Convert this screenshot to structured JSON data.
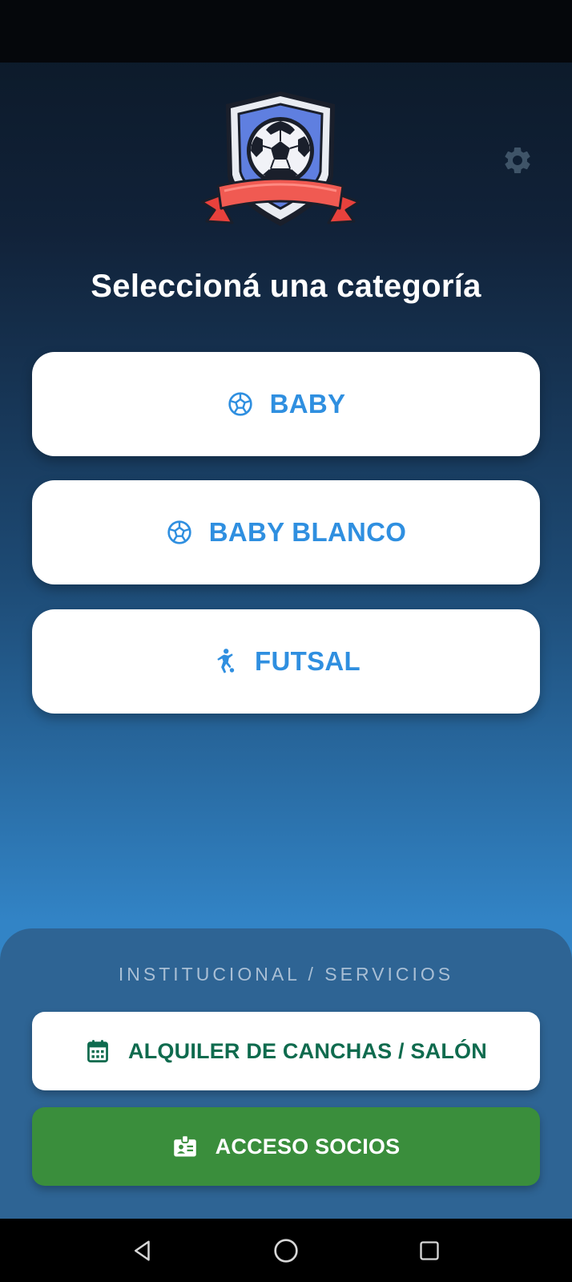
{
  "header": {
    "title": "Seleccioná una categoría"
  },
  "categories": [
    {
      "label": "BABY",
      "icon": "soccer-ball-icon"
    },
    {
      "label": "BABY BLANCO",
      "icon": "soccer-ball-icon"
    },
    {
      "label": "FUTSAL",
      "icon": "player-kick-icon"
    }
  ],
  "services": {
    "title": "INSTITUCIONAL / SERVICIOS",
    "items": [
      {
        "label": "ALQUILER DE CANCHAS / SALÓN",
        "icon": "calendar-icon"
      },
      {
        "label": "ACCESO SOCIOS",
        "icon": "id-badge-icon"
      }
    ]
  },
  "colors": {
    "accent_blue": "#2f8fe0",
    "green_text": "#0f6b4e",
    "green_button": "#3a8e3c",
    "panel": "#2e6494"
  },
  "nav": {
    "buttons": [
      "back-icon",
      "home-icon",
      "recents-icon"
    ]
  }
}
